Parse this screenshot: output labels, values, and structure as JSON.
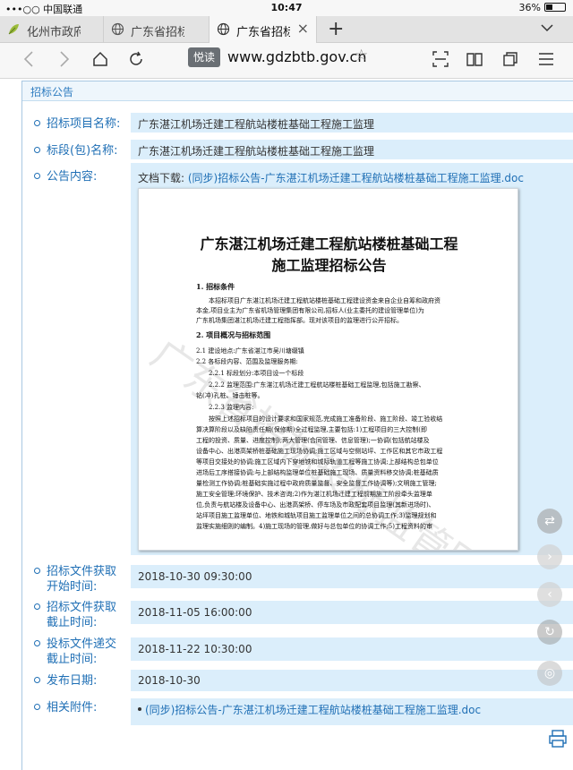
{
  "statusbar": {
    "carrier": "•••○○ 中国联通",
    "time": "10:47",
    "battery": "36%"
  },
  "tabs": [
    {
      "title": "化州市政府"
    },
    {
      "title": "广东省招标"
    },
    {
      "title": "广东省招标"
    }
  ],
  "toolbar": {
    "reader": "悦读",
    "url": "www.gdzbtb.gov.cn"
  },
  "panel": {
    "title": "招标公告"
  },
  "fields": {
    "project_name_label": "招标项目名称:",
    "project_name": "广东湛江机场迁建工程航站楼桩基础工程施工监理",
    "section_label": "标段(包)名称:",
    "section": "广东湛江机场迁建工程航站楼桩基础工程施工监理",
    "content_label": "公告内容:",
    "doc_download_prefix": "文档下载:",
    "doc_link": "(同步)招标公告-广东湛江机场迁建工程航站楼桩基础工程施工监理.doc",
    "get_start_label_1": "招标文件获取",
    "get_start_label_2": "开始时间:",
    "get_start": "2018-10-30 09:30:00",
    "get_end_label_1": "招标文件获取",
    "get_end_label_2": "截止时间:",
    "get_end": "2018-11-05 16:00:00",
    "submit_end_label_1": "投标文件递交",
    "submit_end_label_2": "截止时间:",
    "submit_end": "2018-11-22 10:30:00",
    "publish_label": "发布日期:",
    "publish": "2018-10-30",
    "attach_label": "相关附件:",
    "attachment": "(同步)招标公告-广东湛江机场迁建工程航站楼桩基础工程施工监理.doc"
  },
  "document": {
    "title_line1": "广东湛江机场迁建工程航站楼桩基础工程",
    "title_line2": "施工监理招标公告",
    "h1": "1. 招标条件",
    "p1": "本招标项目广东湛江机场迁建工程航站楼桩基础工程建设资金来自企业自筹和政府资",
    "p2": "本金,项目业主为广东省机场管理集团有限公司,招标人(业主委托的建设管理单位)为",
    "p3": "广东机场集团湛江机场迁建工程指挥部。现对该项目的监理进行公开招标。",
    "h2": "2. 项目概况与招标范围",
    "p4": "2.1 建设地点:广东省湛江市吴川塘缀镇",
    "p5": "2.2 各标段内容、范围及监理服务期:",
    "p6": "2.2.1 标段划分:本项目设一个标段",
    "p7": "2.2.2 监理范围:广东湛江机场迁建工程航站楼桩基础工程监理,包括施工勘察、",
    "p8": "钻(冲)孔桩、锤击桩等。",
    "p9": "2.2.3 监理内容:",
    "p10": "按照上述招标项目的设计要求和国家规范,完成施工准备阶段、施工阶段、竣工验收结",
    "p11": "算决算阶段以及缺陷责任期(保修期)全过程监理,主要包括:1)工程项目的三大控制(即",
    "p12": "工程的投资、质量、进度控制);两大管理(合同管理、信息管理);一协调(包括航站楼及",
    "p13": "设备中心、出港高架桥桩基础施工现场协调;施工区域与空侧站坪、工作区和其它市政工程",
    "p14": "等项目交接处的协调;施工区域内下穿地铁和城际轨道工程等施工协调;上部结构总包单位",
    "p15": "进场后工序搭接协调;与上部结构监理单位桩基础施工现场、质量资料移交协调;桩基础质",
    "p16": "量检测工作协调;桩基础实施过程中政府质量监督、安全监督工作协调等);文明施工管理;",
    "p17": "施工安全管理;环境保护、技术咨询;2)作为湛江机场迁建工程前期施工阶段牵头监理单",
    "p18": "位,负责与航站楼及设备中心、出港高架桥、停车场及市政配套项目监理(其新进场时)、",
    "p19": "站坪项目施工监理单位、地铁和城轨项目施工监理单位之间的总协调工作;3)监理规划和",
    "p20": "监理实施细则的编制。4)施工现场的管理,做好与总包单位的协调工作;5)工程资料的审",
    "watermark": "广东省招标投标监管网"
  }
}
